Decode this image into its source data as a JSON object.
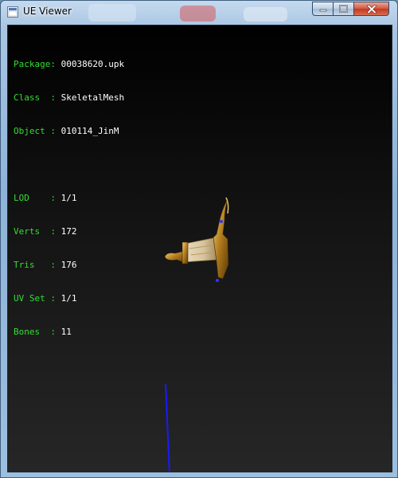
{
  "window": {
    "title": "UE Viewer",
    "controls": {
      "minimize": "minimize",
      "maximize": "maximize",
      "close": "close"
    }
  },
  "info": {
    "group1": [
      {
        "key": "Package: ",
        "value": "00038620.upk"
      },
      {
        "key": "Class  : ",
        "value": "SkeletalMesh"
      },
      {
        "key": "Object : ",
        "value": "010114_JinM"
      }
    ],
    "group2": [
      {
        "key": "LOD    : ",
        "value": "1/1"
      },
      {
        "key": "Verts  : ",
        "value": "172"
      },
      {
        "key": "Tris   : ",
        "value": "176"
      },
      {
        "key": "UV Set : ",
        "value": "1/1"
      },
      {
        "key": "Bones  : ",
        "value": "11"
      }
    ]
  },
  "colors": {
    "label": "#33dd33",
    "value": "#ffffff",
    "axis": "#1a1aff"
  }
}
